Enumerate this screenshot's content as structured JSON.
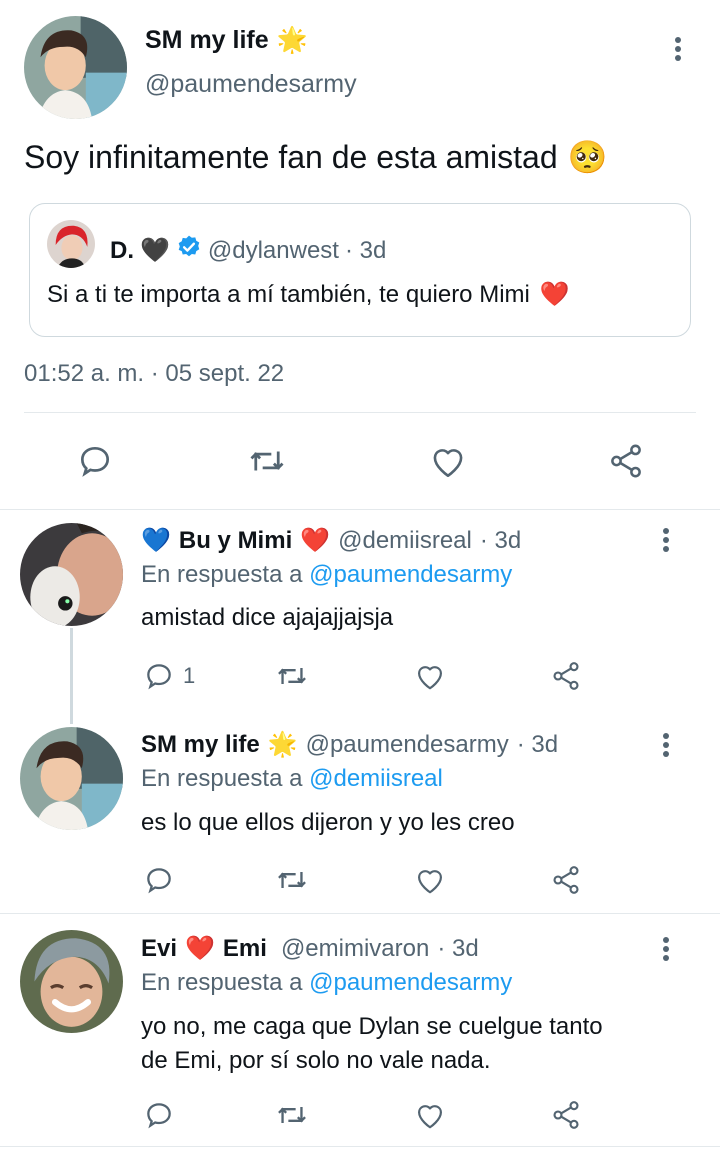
{
  "tweet": {
    "author_name": "SM my life",
    "author_emoji": "🌟",
    "author_handle": "@paumendesarmy",
    "text": "Soy infinitamente fan de esta amistad",
    "text_emoji": "🥺",
    "timestamp": "01:52 a. m. · 05 sept. 22",
    "quote": {
      "name": "D.",
      "name_emoji": "🖤",
      "verified": true,
      "handle": "@dylanwest",
      "time": "· 3d",
      "text": "Si a ti te importa a mí también, te quiero Mimi",
      "text_emoji": "❤️"
    },
    "actions": [
      "reply-icon",
      "retweet-icon",
      "like-icon",
      "share-icon"
    ]
  },
  "replies": [
    {
      "name_prefix_emoji": "💙",
      "name": "Bu y Mimi",
      "name_suffix_emoji": "❤️",
      "handle": "@demiisreal",
      "time": "· 3d",
      "replying_label": "En respuesta a",
      "replying_to": "@paumendesarmy",
      "text": "amistad dice ajajajjajsja",
      "reply_count": "1"
    },
    {
      "name": "SM my life",
      "name_suffix_emoji": "🌟",
      "handle": "@paumendesarmy",
      "time": "· 3d",
      "replying_label": "En respuesta a",
      "replying_to": "@demiisreal",
      "text": "es lo que ellos dijeron y yo les creo"
    },
    {
      "name_a": "Evi",
      "name_mid_emoji": "❤️",
      "name_b": "Emi",
      "handle": "@emimivaron",
      "time": "· 3d",
      "replying_label": "En respuesta a",
      "replying_to": "@paumendesarmy",
      "text_line1": "yo no, me caga que Dylan se cuelgue tanto",
      "text_line2": "de Emi, por sí solo no vale nada."
    }
  ],
  "colors": {
    "text": "#0f1419",
    "muted": "#536471",
    "link": "#1d9bf0",
    "verified": "#1d9bf0",
    "heart_red": "#e0245e"
  }
}
